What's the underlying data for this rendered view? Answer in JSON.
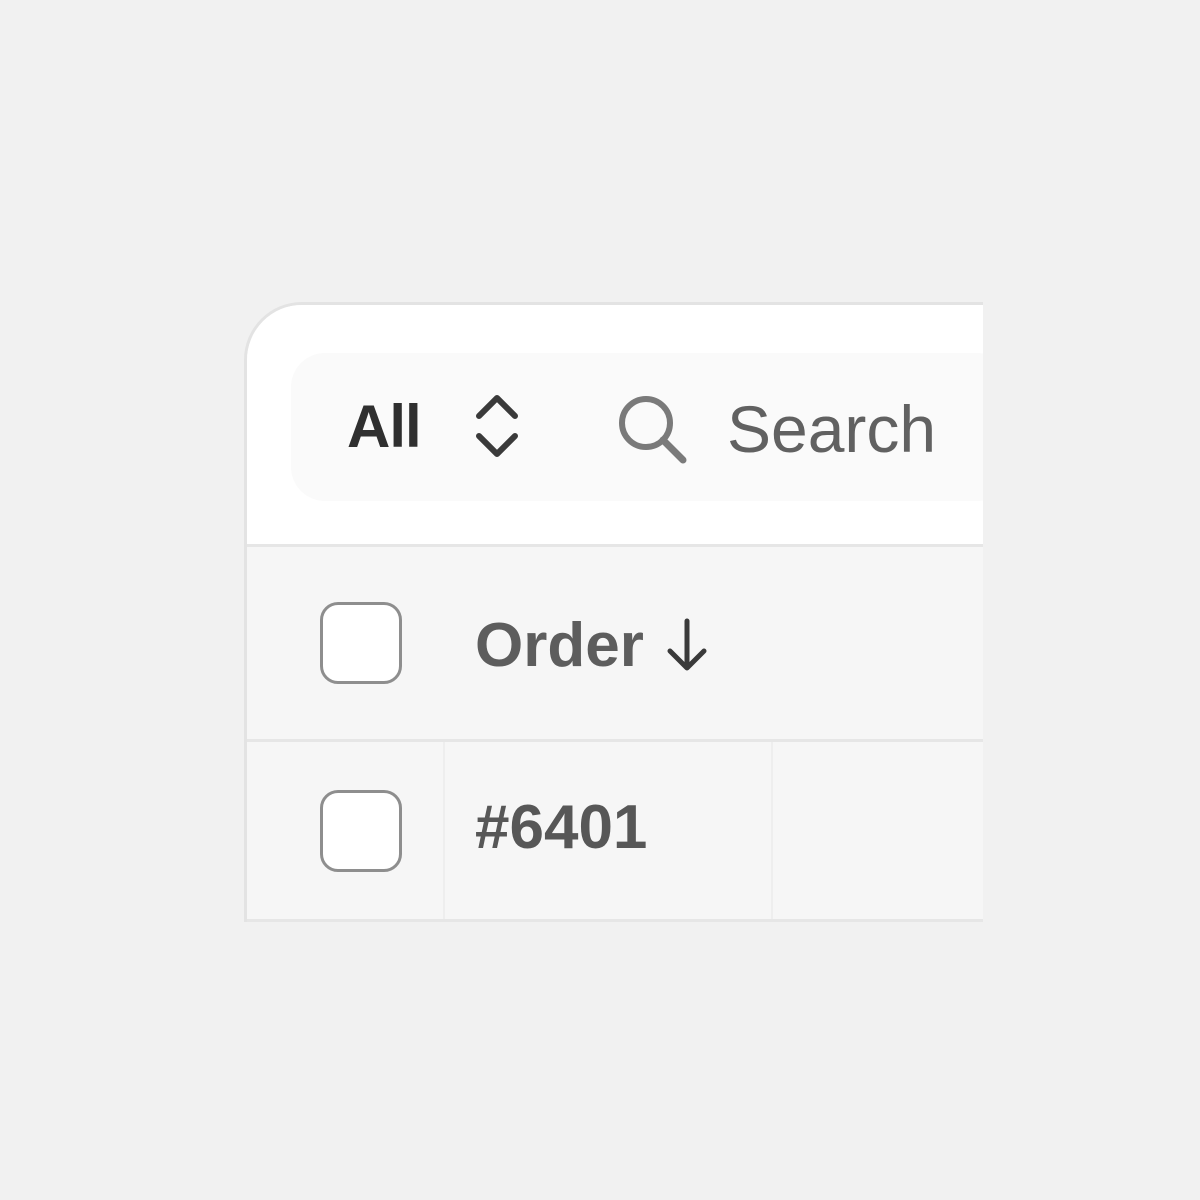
{
  "toolbar": {
    "filter_label": "All",
    "filter_icon": "chevron-up-down-icon",
    "search_icon": "search-icon",
    "search_placeholder": "Search"
  },
  "table": {
    "columns": [
      {
        "label": "Order",
        "sort": "descending",
        "sort_icon": "arrow-down-icon"
      }
    ],
    "rows": [
      {
        "order": "#6401",
        "selected": false
      }
    ],
    "header_checkbox_selected": false
  },
  "colors": {
    "page_background": "#f1f1f1",
    "card_border": "#e3e3e3",
    "checkbox_border": "#8e8e8e",
    "text_primary": "#2f2f2f",
    "text_secondary": "#5d5d5d"
  }
}
